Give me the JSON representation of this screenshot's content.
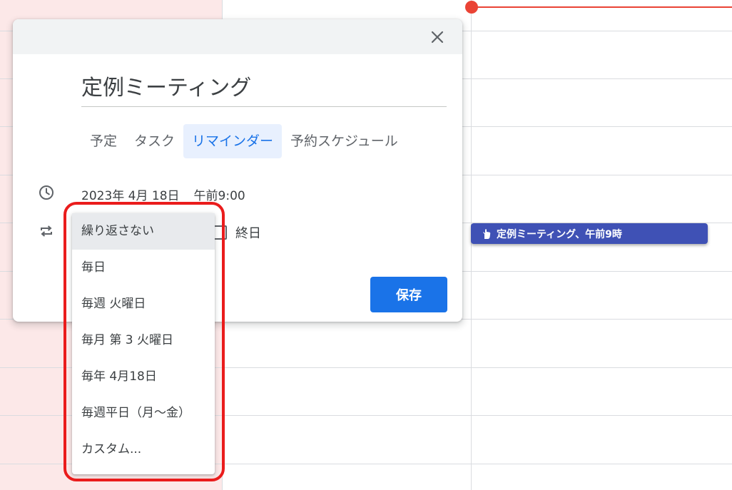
{
  "colors": {
    "accent": "#1a73e8",
    "event_chip": "#3f51b5",
    "current_time": "#ea4335",
    "annotation": "#ea1c1c",
    "past_bg": "#fce8e8"
  },
  "calendar": {
    "event_chip_label": "定例ミーティング、午前9時",
    "event_chip_icon": "hand-icon"
  },
  "dialog": {
    "close_icon": "close-icon",
    "title": "定例ミーティング",
    "tabs": [
      {
        "label": "予定",
        "active": false
      },
      {
        "label": "タスク",
        "active": false
      },
      {
        "label": "リマインダー",
        "active": true
      },
      {
        "label": "予約スケジュール",
        "active": false
      }
    ],
    "date_icon": "clock-icon",
    "date": "2023年 4月 18日",
    "time": "午前9:00",
    "repeat_icon": "repeat-icon",
    "allday_label": "終日",
    "allday_checked": false,
    "save_label": "保存"
  },
  "repeat_menu": {
    "selected_index": 0,
    "options": [
      "繰り返さない",
      "毎日",
      "毎週 火曜日",
      "毎月 第 3 火曜日",
      "毎年 4月18日",
      "毎週平日（月～金）",
      "カスタム..."
    ]
  }
}
